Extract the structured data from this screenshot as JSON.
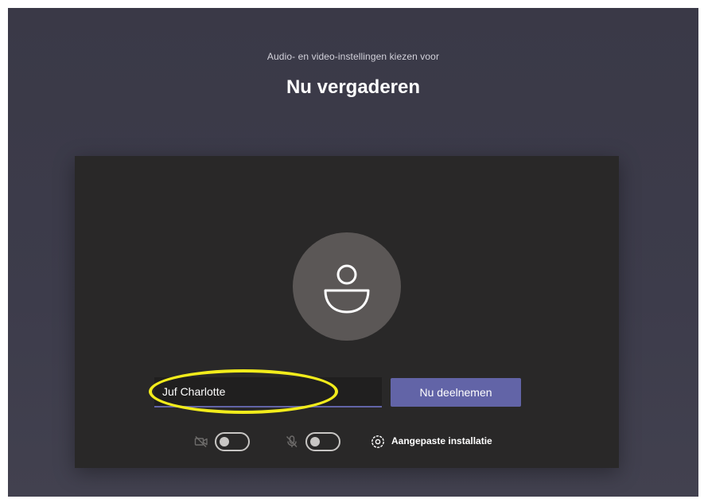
{
  "header": {
    "subtitle": "Audio- en video-instellingen kiezen voor",
    "title": "Nu vergaderen"
  },
  "prejoin": {
    "avatar_icon": "person-icon",
    "name_input": {
      "value": "Juf Charlotte",
      "placeholder": ""
    },
    "join_button_label": "Nu deelnemen",
    "camera": {
      "icon": "camera-off-icon",
      "enabled": false
    },
    "microphone": {
      "icon": "mic-off-icon",
      "enabled": false
    },
    "settings": {
      "icon": "gear-icon",
      "label": "Aangepaste installatie"
    }
  },
  "colors": {
    "background": "#3b3a48",
    "panel": "#292828",
    "accent": "#6264a7",
    "highlight": "#f2ec1b"
  }
}
